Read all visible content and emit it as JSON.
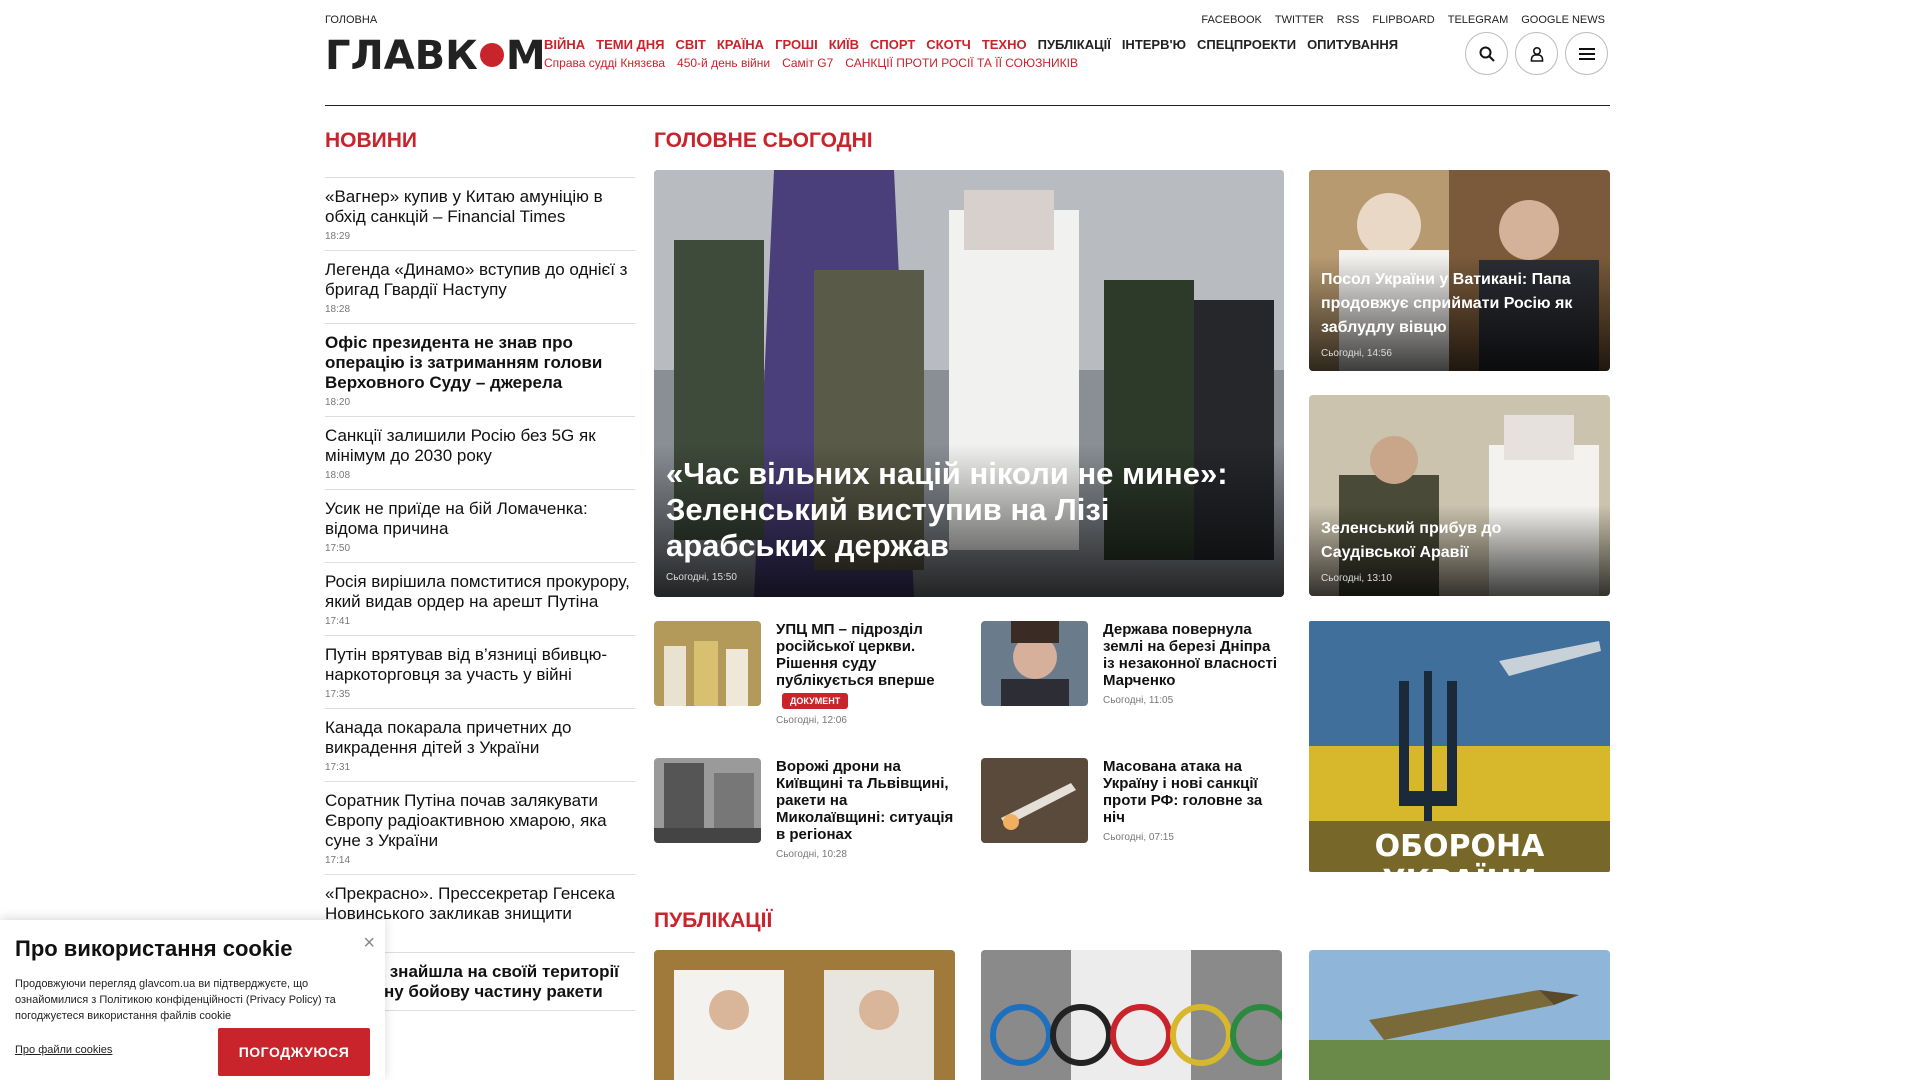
{
  "header": {
    "crumb": "ГОЛОВНА",
    "logo": "ГЛАВКОМ",
    "social": [
      "FACEBOOK",
      "TWITTER",
      "RSS",
      "FLIPBOARD",
      "TELEGRAM",
      "GOOGLE NEWS"
    ],
    "nav": [
      {
        "label": "ВІЙНА",
        "accent": true
      },
      {
        "label": "ТЕМИ ДНЯ",
        "accent": true
      },
      {
        "label": "СВІТ",
        "accent": true
      },
      {
        "label": "КРАЇНА",
        "accent": true
      },
      {
        "label": "ГРОШІ",
        "accent": true
      },
      {
        "label": "КИЇВ",
        "accent": true
      },
      {
        "label": "СПОРТ",
        "accent": true
      },
      {
        "label": "СКОТЧ",
        "accent": true
      },
      {
        "label": "ТЕХНО",
        "accent": true
      },
      {
        "label": "ПУБЛІКАЦІЇ",
        "accent": false
      },
      {
        "label": "ІНТЕРВ'Ю",
        "accent": false
      },
      {
        "label": "СПЕЦПРОЕКТИ",
        "accent": false
      },
      {
        "label": "ОПИТУВАННЯ",
        "accent": false
      }
    ],
    "subnav": [
      "Справа судді Князєва",
      "450-й день війни",
      "Саміт G7",
      "САНКЦІЇ ПРОТИ РОСІЇ ТА ЇЇ СОЮЗНИКІВ"
    ],
    "icons": [
      "search-icon",
      "user-icon",
      "menu-icon"
    ]
  },
  "news": {
    "title": "НОВИНИ",
    "items": [
      {
        "title": "«Вагнер» купив у Китаю амуніцію в обхід санкцій – Financial Times",
        "time": "18:29",
        "bold": false
      },
      {
        "title": "Легенда «Динамо» вступив до однієї з бригад Гвардії Наступу",
        "time": "18:28",
        "bold": false
      },
      {
        "title": "Офіс президента не знав про операцію із затриманням голови Верховного Суду – джерела",
        "time": "18:20",
        "bold": true
      },
      {
        "title": "Санкції залишили Росію без 5G як мінімум до 2030 року",
        "time": "18:08",
        "bold": false
      },
      {
        "title": "Усик не приїде на бій Ломаченка: відома причина",
        "time": "17:50",
        "bold": false
      },
      {
        "title": "Росія вирішила помститися прокурору, який видав ордер на арешт Путіна",
        "time": "17:41",
        "bold": false
      },
      {
        "title": "Путін врятував від в’язниці вбивцю-наркоторговця за участь у війні",
        "time": "17:35",
        "bold": false
      },
      {
        "title": "Канада покарала причетних до викрадення дітей з України",
        "time": "17:31",
        "bold": false
      },
      {
        "title": "Соратник Путіна почав залякувати Європу радіоактивною хмарою, яка суне з України",
        "time": "17:14",
        "bold": false
      },
      {
        "title": "«Прекрасно». Прессекретар Генсека Новинського закликав знищити Україну",
        "time": "",
        "bold": false
      },
      {
        "title": "Канада знайшла на своїй території незвичну бойову частину ракети",
        "time": "",
        "bold": true
      }
    ]
  },
  "main": {
    "title": "ГОЛОВНЕ СЬОГОДНІ",
    "hero": {
      "title": "«Час вільних націй ніколи не мине»: Зеленський виступив на Лізі арабських держав",
      "date": "Сьогодні, 15:50"
    },
    "side1": {
      "title": "Посол України у Ватикані: Папа продовжує сприймати Росію як заблудлу вівцю",
      "date": "Сьогодні, 14:56"
    },
    "side2": {
      "title": "Зеленський прибув до Саудівської Аравії",
      "date": "Сьогодні, 13:10"
    },
    "small": [
      {
        "title": "УПЦ МП – підрозділ російської церкви. Рішення суду публікується вперше",
        "badge": "ДОКУМЕНТ",
        "date": "Сьогодні, 12:06"
      },
      {
        "title": "Держава повернула землі на березі Дніпра із незаконної власності Марченко",
        "date": "Сьогодні, 11:05"
      },
      {
        "title": "Ворожі дрони на Київщині та Львівщині, ракети на Миколаївщині: ситуація в регіонах",
        "date": "Сьогодні, 10:28"
      },
      {
        "title": "Масована атака на Україну і нові санкції проти РФ: головне за ніч",
        "date": "Сьогодні, 07:15"
      }
    ],
    "promo": "ОБОРОНА УКРАЇНИ"
  },
  "publications": {
    "title": "ПУБЛІКАЦІЇ"
  },
  "cookie": {
    "title": "Про використання cookie",
    "text": "Продовжуючи перегляд glavcom.ua ви підтверджуєте, що ознайомилися з Політикою конфіденційності (Privacy Policy) та погоджуєтеся використання файлів cookie",
    "link": "Про файли cookies",
    "button": "ПОГОДЖУЮСЯ",
    "close": "×"
  },
  "colors": {
    "accent": "#c9232b"
  }
}
